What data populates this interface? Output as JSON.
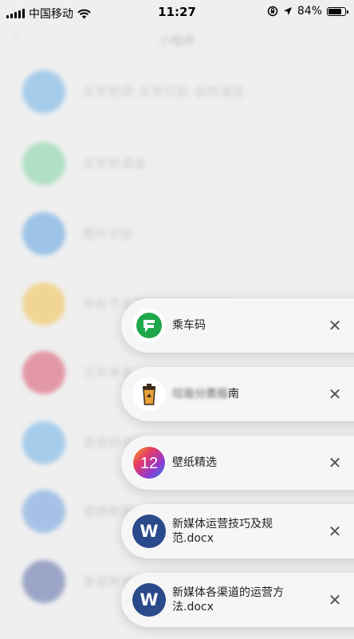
{
  "status_bar": {
    "carrier": "中国移动",
    "time": "11:27",
    "battery_percent": "84%",
    "battery_level": 0.84
  },
  "background": {
    "title": "小程序",
    "rows": [
      {
        "text": "文字检测 文字识别 自然语言",
        "color": "#6ab0e8"
      },
      {
        "text": "文字转语音",
        "color": "#7ed3a0"
      },
      {
        "text": "图片识别",
        "color": "#5aa0e0"
      },
      {
        "text": "中秋节文案朋友圈文案大全",
        "color": "#f2c14e"
      },
      {
        "text": "汉字拼音",
        "color": "#d9506a"
      },
      {
        "text": "语音转文字",
        "color": "#6ab0e8"
      },
      {
        "text": "视频提取",
        "color": "#6a9ee0"
      },
      {
        "text": "录音转写",
        "color": "#5a6aa8"
      }
    ]
  },
  "notifications": [
    {
      "app_icon": "g-logo-icon",
      "title": "乘车码",
      "title_blurred": "",
      "icon_color": "#1fa84a"
    },
    {
      "app_icon": "trash-bin-icon",
      "title": "南",
      "title_blurred": "垃圾分类指",
      "icon_color": "#d08a2a"
    },
    {
      "app_icon": "colorful-12-icon",
      "title": "壁纸精选",
      "title_blurred": "",
      "icon_color": "#c2407a"
    },
    {
      "app_icon": "word-icon",
      "title": "新媒体运营技巧及规范.docx",
      "title_blurred": "",
      "icon_letter": "W",
      "icon_color": "#2b4a8b"
    },
    {
      "app_icon": "word-icon",
      "title": "新媒体各渠道的运营方法.docx",
      "title_blurred": "",
      "icon_letter": "W",
      "icon_color": "#2b4a8b"
    }
  ],
  "close_symbol": "✕"
}
